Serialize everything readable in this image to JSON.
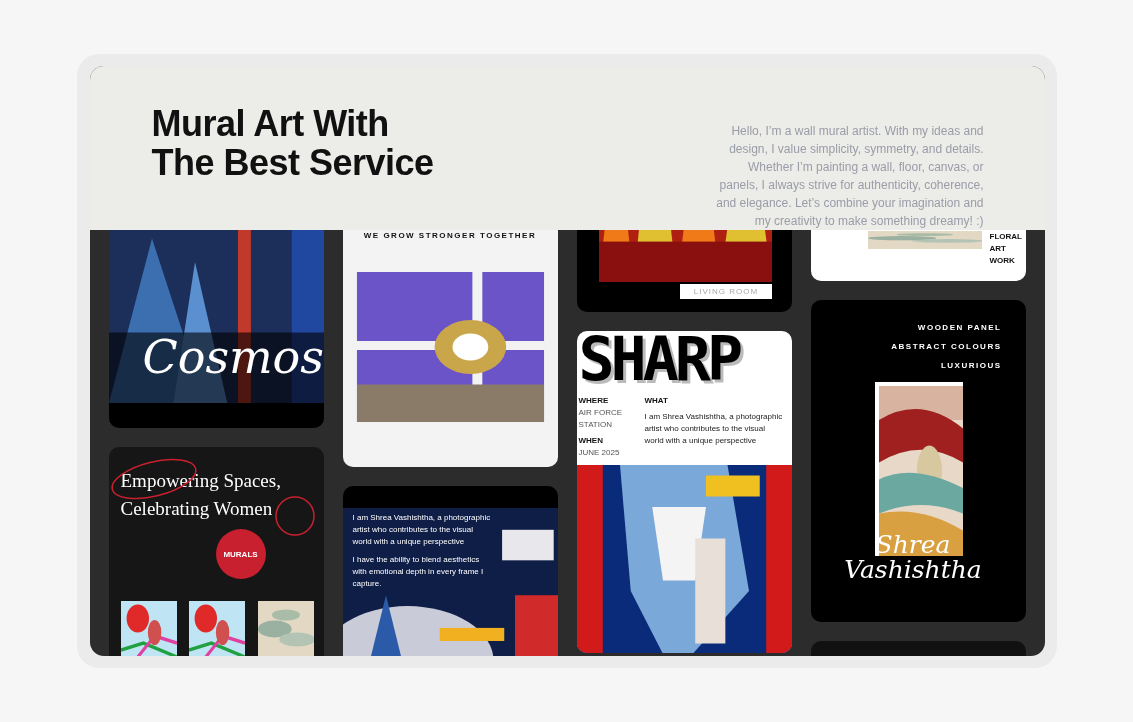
{
  "header": {
    "title_lines": [
      "Mural Art With",
      "The Best Service"
    ],
    "description": "Hello, I’m a wall mural artist. With my ideas and design, I value simplicity, symmetry, and details. Whether I’m painting a wall, floor, canvas, or panels, I always strive for authenticity, coherence, and elegance. Let’s combine your imagination and my creativity to make something dreamy! :)"
  },
  "columns": [
    [
      {
        "kind": "script",
        "caption": "Cosmos"
      },
      {
        "kind": "empowering",
        "heading_lines": [
          "Empowering Spaces,",
          "Celebrating Women"
        ],
        "badge": "MURALS"
      }
    ],
    [
      {
        "kind": "panels",
        "tagline": "WE GROW STRONGER TOGETHER"
      },
      {
        "kind": "text-over-picture",
        "paragraphs": [
          "I am Shrea Vashishtha, a photographic artist who contributes to the visual world with a unique perspective",
          "I have the ability to blend aesthetics with emotional depth in every frame I capture."
        ]
      }
    ],
    [
      {
        "kind": "label-picture",
        "label": "LIVING ROOM"
      },
      {
        "kind": "sharp",
        "headline": "SHARP",
        "where_label": "WHERE",
        "where": "AIR FORCE STATION",
        "when_label": "WHEN",
        "when": "JUNE 2025",
        "what_label": "WHAT",
        "what": "I am Shrea Vashishtha, a photographic artist who contributes to the visual world with a unique perspective"
      }
    ],
    [
      {
        "kind": "side-label",
        "label_lines": [
          "FLORAL",
          "ART",
          "WORK"
        ]
      },
      {
        "kind": "wooden",
        "labels": [
          "WOODEN PANEL",
          "ABSTRACT COLOURS",
          "LUXURIOUS"
        ],
        "signature_lines": [
          "Shrea",
          "Vashishtha"
        ]
      },
      {
        "kind": "blank"
      }
    ]
  ]
}
